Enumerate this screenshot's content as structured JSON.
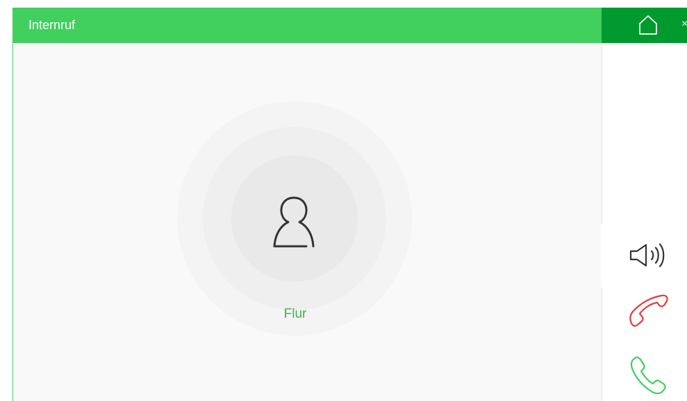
{
  "header": {
    "title": "Internruf",
    "close_label": "×"
  },
  "caller": {
    "name": "Flur",
    "icon": "person-icon"
  },
  "side_panel": {
    "home_icon": "home-icon",
    "actions": [
      {
        "name": "speaker",
        "icon": "speaker-icon"
      },
      {
        "name": "hang-up",
        "icon": "hangup-phone-icon"
      },
      {
        "name": "answer",
        "icon": "answer-phone-icon"
      }
    ]
  },
  "colors": {
    "header_green": "#41d05e",
    "side_header_green": "#009a2e",
    "caller_name_green": "#47b04a",
    "hangup_red": "#e8393b",
    "answer_green": "#3ecf5d"
  }
}
